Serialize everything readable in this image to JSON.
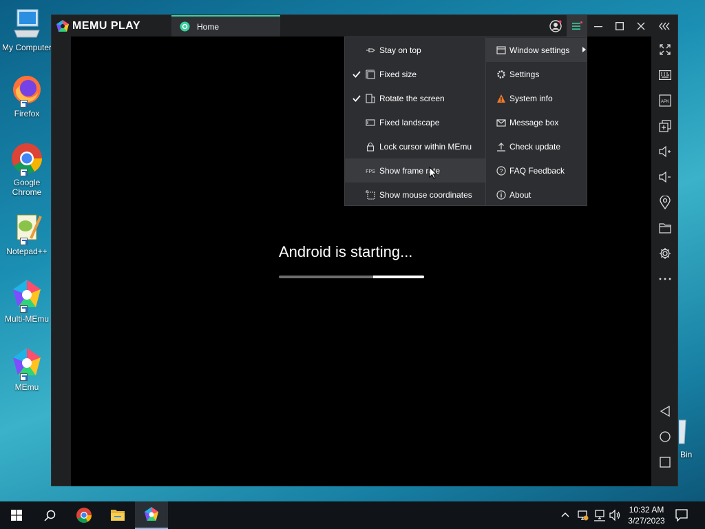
{
  "desktop": {
    "icons": [
      {
        "label": "My Computer",
        "icon": "my-computer-icon"
      },
      {
        "label": "Firefox",
        "icon": "firefox-icon"
      },
      {
        "label": "Google Chrome",
        "icon": "chrome-icon"
      },
      {
        "label": "Notepad++",
        "icon": "notepad-plus-plus-icon"
      },
      {
        "label": "Multi-MEmu",
        "icon": "multi-memu-icon"
      },
      {
        "label": "MEmu",
        "icon": "memu-icon"
      }
    ],
    "partial_icon_label": "Bin"
  },
  "memu": {
    "logo_text": "MEMU PLAY",
    "tab": {
      "label": "Home",
      "icon": "home-app-icon"
    },
    "title_buttons": [
      "account-icon",
      "menu-icon",
      "minimize-icon",
      "maximize-icon",
      "close-icon",
      "collapse-sidebar-icon"
    ],
    "boot_message": "Android is starting...",
    "boot_progress": {
      "start": 0.65,
      "end": 1.0
    },
    "sidebar_icons": [
      "fullscreen-icon",
      "keyboard-icon",
      "apk-icon",
      "multi-window-icon",
      "volume-up-icon",
      "volume-down-icon",
      "location-icon",
      "folder-icon",
      "settings-icon",
      "more-icon"
    ],
    "nav_icons": [
      "back-icon",
      "home-icon",
      "recents-icon"
    ]
  },
  "window_settings_submenu": [
    {
      "label": "Stay on top",
      "icon": "pin-icon",
      "checked": false
    },
    {
      "label": "Fixed size",
      "icon": "fixed-size-icon",
      "checked": true
    },
    {
      "label": "Rotate the screen",
      "icon": "rotate-icon",
      "checked": true
    },
    {
      "label": "Fixed landscape",
      "icon": "landscape-icon",
      "checked": false
    },
    {
      "label": "Lock cursor within MEmu",
      "icon": "lock-icon",
      "checked": false
    },
    {
      "label": "Show frame rate",
      "icon": "fps-icon",
      "checked": false,
      "hovered": true
    },
    {
      "label": "Show mouse coordinates",
      "icon": "coordinates-icon",
      "checked": false
    }
  ],
  "main_menu": [
    {
      "label": "Window settings",
      "icon": "window-icon",
      "has_submenu": true
    },
    {
      "label": "Settings",
      "icon": "gear-icon"
    },
    {
      "label": "System info",
      "icon": "warning-icon"
    },
    {
      "label": "Message box",
      "icon": "mail-icon"
    },
    {
      "label": "Check update",
      "icon": "upload-icon"
    },
    {
      "label": "FAQ  Feedback",
      "icon": "help-icon"
    },
    {
      "label": "About",
      "icon": "info-icon"
    }
  ],
  "taskbar": {
    "apps": [
      "start-icon",
      "search-icon",
      "chrome-icon",
      "file-explorer-icon",
      "memu-icon"
    ],
    "tray_icons": [
      "chevron-up-icon",
      "network-status-icon",
      "network-icon",
      "volume-icon"
    ],
    "time": "10:32 AM",
    "date": "3/27/2023",
    "notification_icon": "notification-icon"
  },
  "colors": {
    "accent": "#3ad29f",
    "menu_bg": "#2d2e31",
    "window_bg": "#1f2022"
  }
}
